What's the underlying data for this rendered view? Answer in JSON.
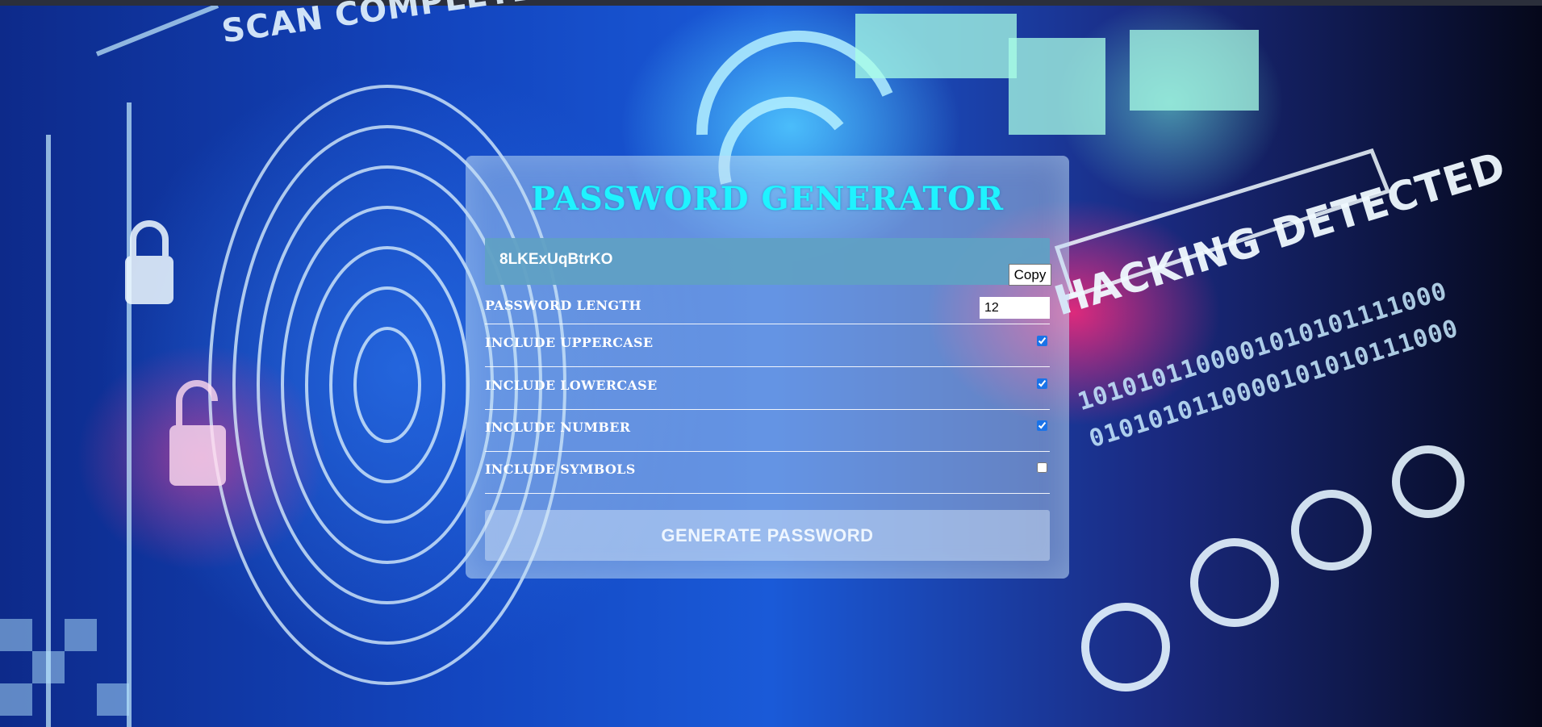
{
  "app": {
    "title": "PASSWORD GENERATOR"
  },
  "result": {
    "password": "8LKExUqBtrKO",
    "copy_label": "Copy"
  },
  "options": {
    "length_label": "PASSWORD LENGTH",
    "length_value": "12",
    "uppercase": {
      "label": "INCLUDE UPPERCASE",
      "checked": true
    },
    "lowercase": {
      "label": "INCLUDE LOWERCASE",
      "checked": true
    },
    "number": {
      "label": "INCLUDE NUMBER",
      "checked": true
    },
    "symbols": {
      "label": "INCLUDE SYMBOLS",
      "checked": false
    }
  },
  "generate_label": "GENERATE PASSWORD",
  "background": {
    "scan_text": "SCAN COMPLETE",
    "hack_text": "HACKING DETECTED",
    "binary_text": "1010101100001010101111000\n0101010110000101010111000"
  },
  "colors": {
    "title": "#1ff3ff",
    "result_bg": "#60a0c4",
    "checkbox_accent": "#1a73e8"
  }
}
